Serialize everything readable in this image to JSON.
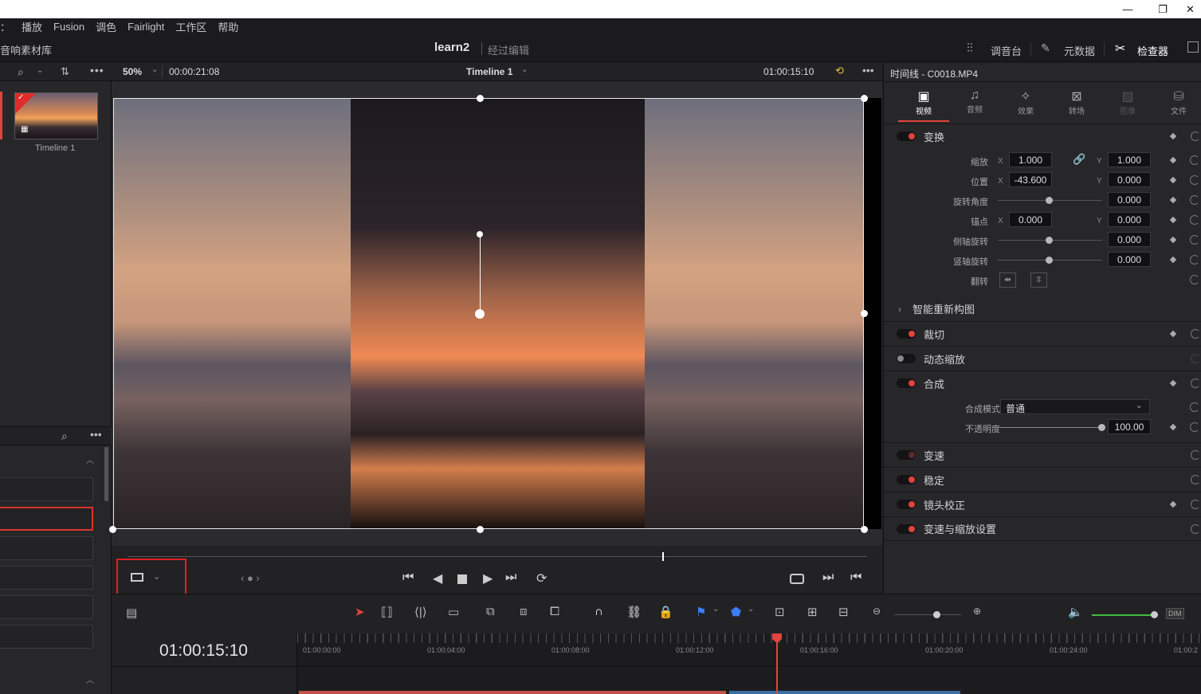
{
  "window": {
    "minimize": "—",
    "maximize": "❐",
    "close": "✕"
  },
  "menu": [
    "：",
    "播放",
    "Fusion",
    "调色",
    "Fairlight",
    "工作区",
    "帮助"
  ],
  "header": {
    "left_label": "音响素材库",
    "project": "learn2",
    "status": "经过编辑",
    "mixer": "调音台",
    "metadata": "元数据",
    "inspector": "检查器"
  },
  "media": {
    "thumb_label": "Timeline 1"
  },
  "viewer": {
    "zoom": "50%",
    "timecode_left": "00:00:21:08",
    "timeline_name": "Timeline 1",
    "timecode_right": "01:00:15:10"
  },
  "inspector": {
    "title": "时间线 - C0018.MP4",
    "tabs": [
      "视频",
      "音频",
      "效果",
      "转场",
      "图像",
      "文件"
    ],
    "transform": {
      "title": "变换",
      "zoom_label": "缩放",
      "zoom_x": "1.000",
      "zoom_y": "1.000",
      "pos_label": "位置",
      "pos_x": "-43.600",
      "pos_y": "0.000",
      "rot_label": "旋转角度",
      "rot": "0.000",
      "anchor_label": "锚点",
      "anchor_x": "0.000",
      "anchor_y": "0.000",
      "pitch_label": "侧轴旋转",
      "pitch": "0.000",
      "yaw_label": "竖轴旋转",
      "yaw": "0.000",
      "flip_label": "翻转"
    },
    "smart_reframe": "智能重新构图",
    "crop": "裁切",
    "dynamic_zoom": "动态缩放",
    "composite": {
      "title": "合成",
      "mode_label": "合成模式",
      "mode": "普通",
      "opacity_label": "不透明度",
      "opacity": "100.00"
    },
    "speed": "变速",
    "stabilize": "稳定",
    "lens": "镜头校正",
    "retime": "变速与缩放设置"
  },
  "timeline": {
    "timecode": "01:00:15:10",
    "ruler": [
      "01:00:00:00",
      "01:00:04:00",
      "01:00:08:00",
      "01:00:12:00",
      "01:00:16:00",
      "01:00:20:00",
      "01:00:24:00",
      "01:00:2"
    ],
    "dim": "DIM"
  },
  "colors": {
    "accent": "#e0443c",
    "highlight_box": "#e02020",
    "playhead": "#e0443c",
    "volume": "#3fbf3f"
  }
}
